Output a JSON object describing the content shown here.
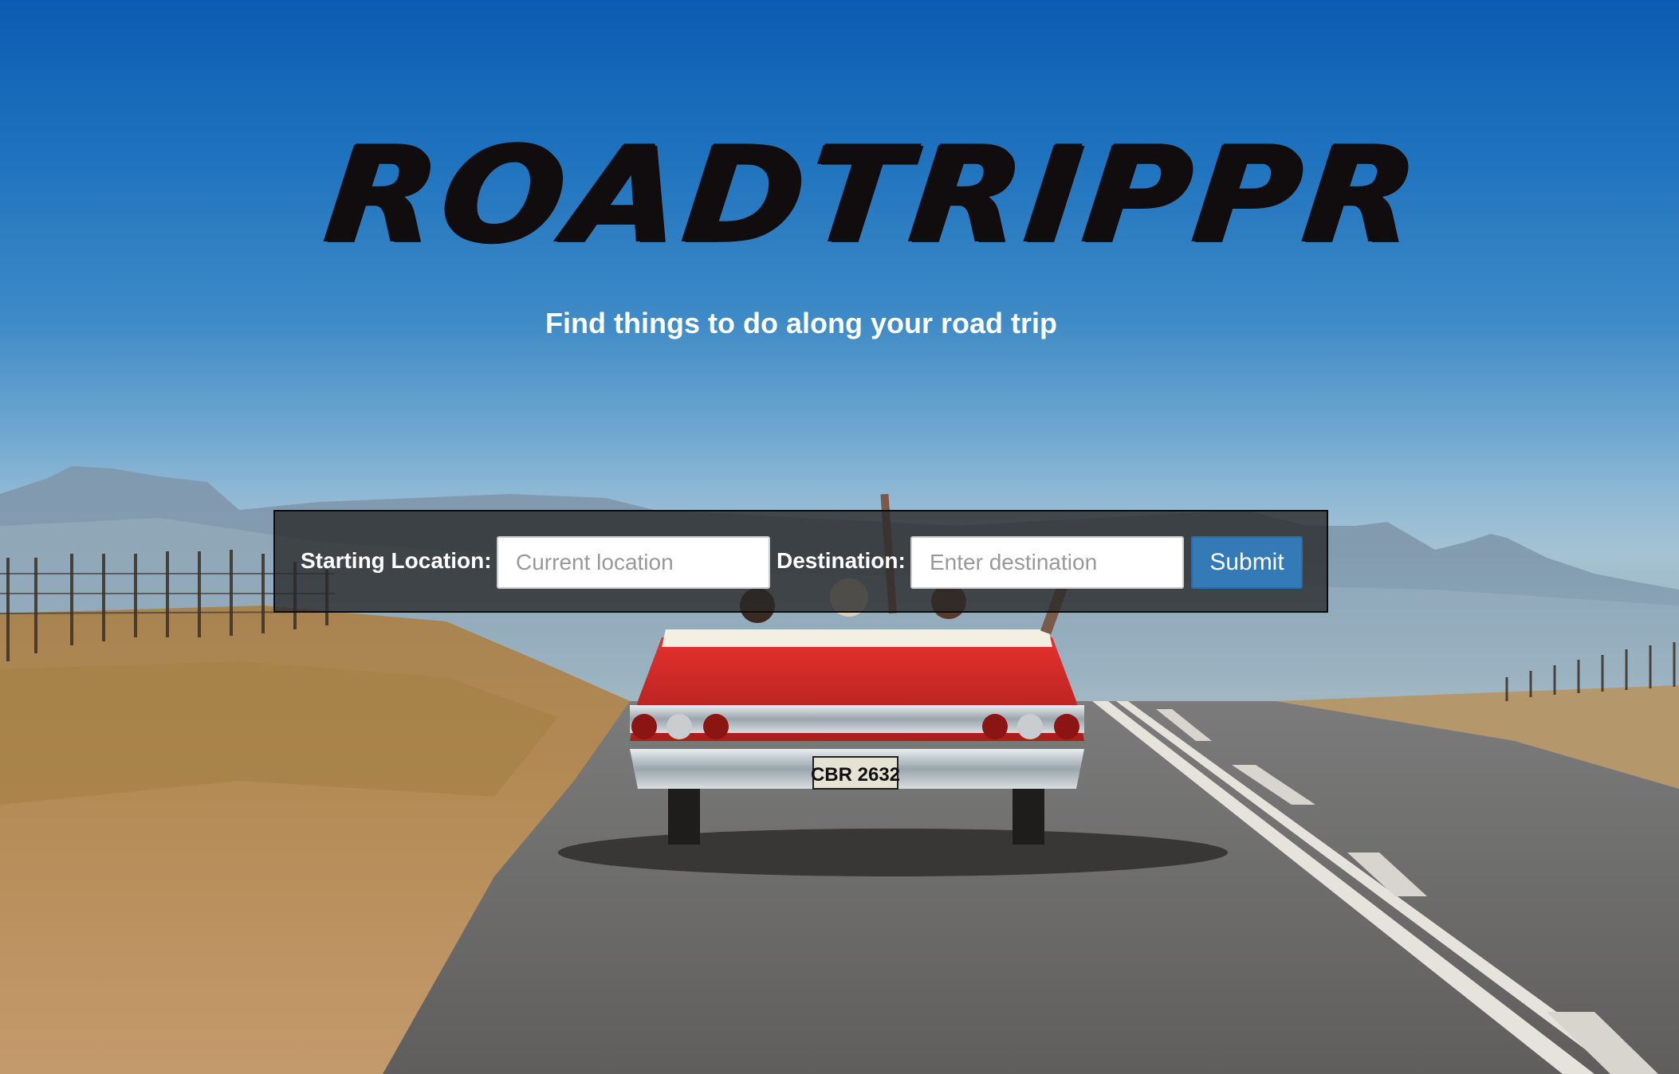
{
  "logo": {
    "text": "ROADTRIPPR",
    "color": "#110c0e"
  },
  "tagline": "Find things to do along your road trip",
  "search_form": {
    "start_label": "Starting Location:",
    "start_placeholder": "Current location",
    "start_value": "",
    "destination_label": "Destination:",
    "destination_placeholder": "Enter destination",
    "destination_value": "",
    "submit_label": "Submit",
    "submit_color": "#337ab7"
  },
  "background": {
    "car_plate": "CBR 2632"
  }
}
